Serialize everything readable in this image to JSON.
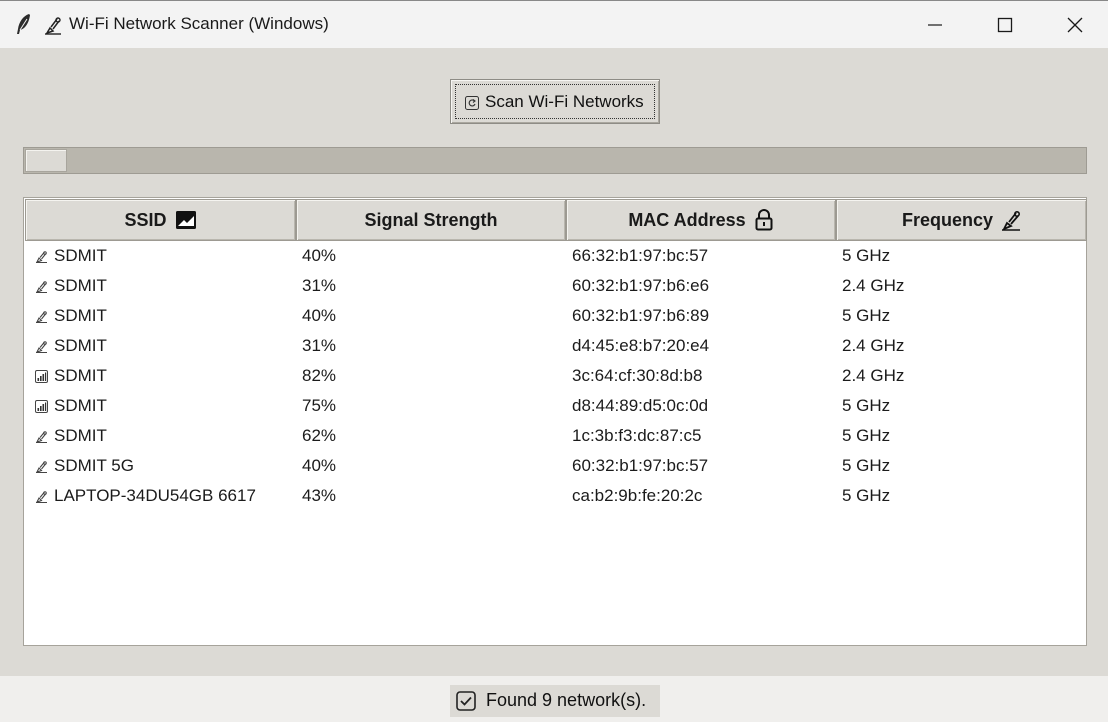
{
  "window": {
    "title": "🛰 Wi-Fi Network Scanner (Windows)",
    "title_text": "Wi-Fi Network Scanner (Windows)"
  },
  "toolbar": {
    "scan_label": "Scan Wi-Fi Networks",
    "scan_icon": "refresh-icon"
  },
  "progress": {
    "value": 0.04
  },
  "table": {
    "columns": [
      {
        "label": "SSID",
        "icon": "image-icon"
      },
      {
        "label": "Signal Strength",
        "icon": ""
      },
      {
        "label": "MAC Address",
        "icon": "lock-icon"
      },
      {
        "label": "Frequency",
        "icon": "satellite-icon"
      }
    ],
    "rows": [
      {
        "icon": "satellite-icon",
        "ssid": "SDMIT",
        "signal": "40%",
        "mac": "66:32:b1:97:bc:57",
        "freq": "5 GHz"
      },
      {
        "icon": "satellite-icon",
        "ssid": "SDMIT",
        "signal": "31%",
        "mac": "60:32:b1:97:b6:e6",
        "freq": "2.4 GHz"
      },
      {
        "icon": "satellite-icon",
        "ssid": "SDMIT",
        "signal": "40%",
        "mac": "60:32:b1:97:b6:89",
        "freq": "5 GHz"
      },
      {
        "icon": "satellite-icon",
        "ssid": "SDMIT",
        "signal": "31%",
        "mac": "d4:45:e8:b7:20:e4",
        "freq": "2.4 GHz"
      },
      {
        "icon": "signal-bars-icon",
        "ssid": "SDMIT",
        "signal": "82%",
        "mac": "3c:64:cf:30:8d:b8",
        "freq": "2.4 GHz"
      },
      {
        "icon": "signal-bars-icon",
        "ssid": "SDMIT",
        "signal": "75%",
        "mac": "d8:44:89:d5:0c:0d",
        "freq": "5 GHz"
      },
      {
        "icon": "satellite-icon",
        "ssid": "SDMIT",
        "signal": "62%",
        "mac": "1c:3b:f3:dc:87:c5",
        "freq": "5 GHz"
      },
      {
        "icon": "satellite-icon",
        "ssid": "SDMIT 5G",
        "signal": "40%",
        "mac": "60:32:b1:97:bc:57",
        "freq": "5 GHz"
      },
      {
        "icon": "satellite-icon",
        "ssid": "LAPTOP-34DU54GB 6617",
        "signal": "43%",
        "mac": "ca:b2:9b:fe:20:2c",
        "freq": "5 GHz"
      }
    ]
  },
  "status": {
    "text": "Found 9 network(s).",
    "icon": "check-box-icon"
  },
  "colors": {
    "window_bg": "#dcdad5",
    "table_bg": "#ffffff",
    "titlebar_bg": "#f3f3f3"
  }
}
